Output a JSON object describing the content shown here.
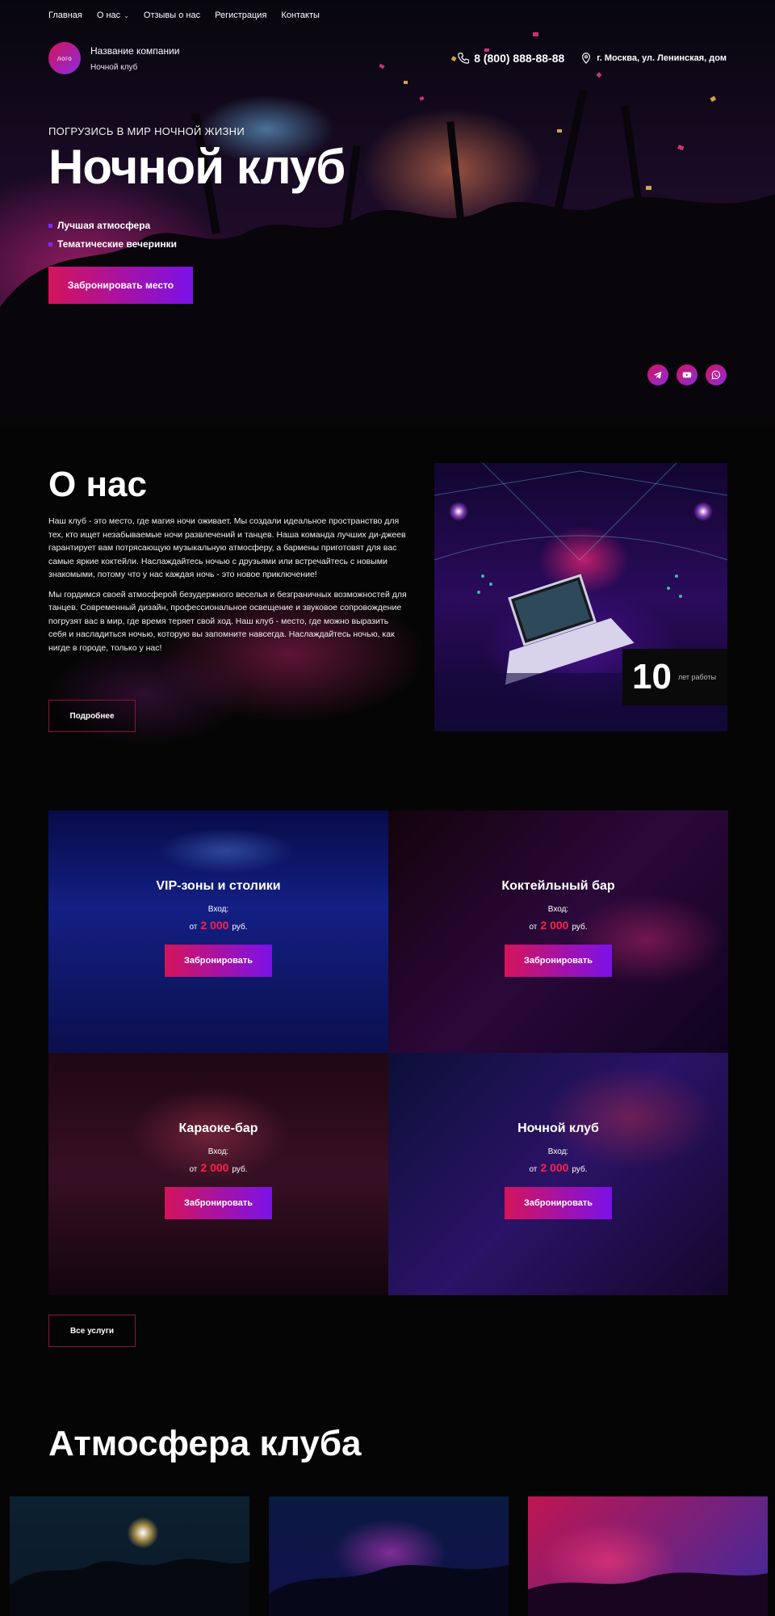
{
  "nav": {
    "items": [
      "Главная",
      "О нас",
      "Отзывы о нас",
      "Регистрация",
      "Контакты"
    ]
  },
  "header": {
    "logo_text": "лого",
    "company_name": "Название компании",
    "company_subtitle": "Ночной клуб",
    "phone": "8 (800) 888-88-88",
    "address": "г. Москва, ул. Ленинская, дом"
  },
  "hero": {
    "kicker": "ПОГРУЗИСЬ В МИР НОЧНОЙ ЖИЗНИ",
    "title": "Ночной клуб",
    "bullets": [
      "Лучшая атмосфера",
      "Тематические вечеринки"
    ],
    "cta": "Забронировать место",
    "socials": [
      "telegram-icon",
      "youtube-icon",
      "whatsapp-icon"
    ]
  },
  "about": {
    "title": "О нас",
    "paragraphs": [
      "Наш клуб - это место, где магия ночи оживает. Мы создали идеальное пространство для тех, кто ищет незабываемые ночи развлечений и танцев. Наша команда лучших ди-джеев гарантирует вам потрясающую музыкальную атмосферу, а бармены приготовят для вас самые яркие коктейли. Наслаждайтесь ночью с друзьями или встречайтесь с новыми знакомыми, потому что у нас каждая ночь - это новое приключение!",
      "Мы гордимся своей атмосферой безудержного веселья и безграничных возможностей для танцев. Современный дизайн, профессиональное освещение и звуковое сопровождение погрузят вас в мир, где время теряет свой ход. Наш клуб - место, где можно выразить себя и насладиться ночью, которую вы запомните навсегда. Наслаждайтесь ночью, как нигде в городе, только у нас!"
    ],
    "more_button": "Подробнее",
    "stat_number": "10",
    "stat_label": "лет работы"
  },
  "services": {
    "items": [
      {
        "title": "VIP-зоны и столики",
        "entry": "Вход:",
        "price_prefix": "от",
        "price": "2 000",
        "currency": "руб.",
        "button": "Забронировать"
      },
      {
        "title": "Коктейльный бар",
        "entry": "Вход:",
        "price_prefix": "от",
        "price": "2 000",
        "currency": "руб.",
        "button": "Забронировать"
      },
      {
        "title": "Караоке-бар",
        "entry": "Вход:",
        "price_prefix": "от",
        "price": "2 000",
        "currency": "руб.",
        "button": "Забронировать"
      },
      {
        "title": "Ночной клуб",
        "entry": "Вход:",
        "price_prefix": "от",
        "price": "2 000",
        "currency": "руб.",
        "button": "Забронировать"
      }
    ],
    "all_button": "Все услуги"
  },
  "atmosphere": {
    "title": "Атмосфера клуба"
  },
  "colors": {
    "accent_pink": "#d4145a",
    "accent_purple": "#7b11e9",
    "price_red": "#ff1f4b",
    "background": "#050505"
  }
}
